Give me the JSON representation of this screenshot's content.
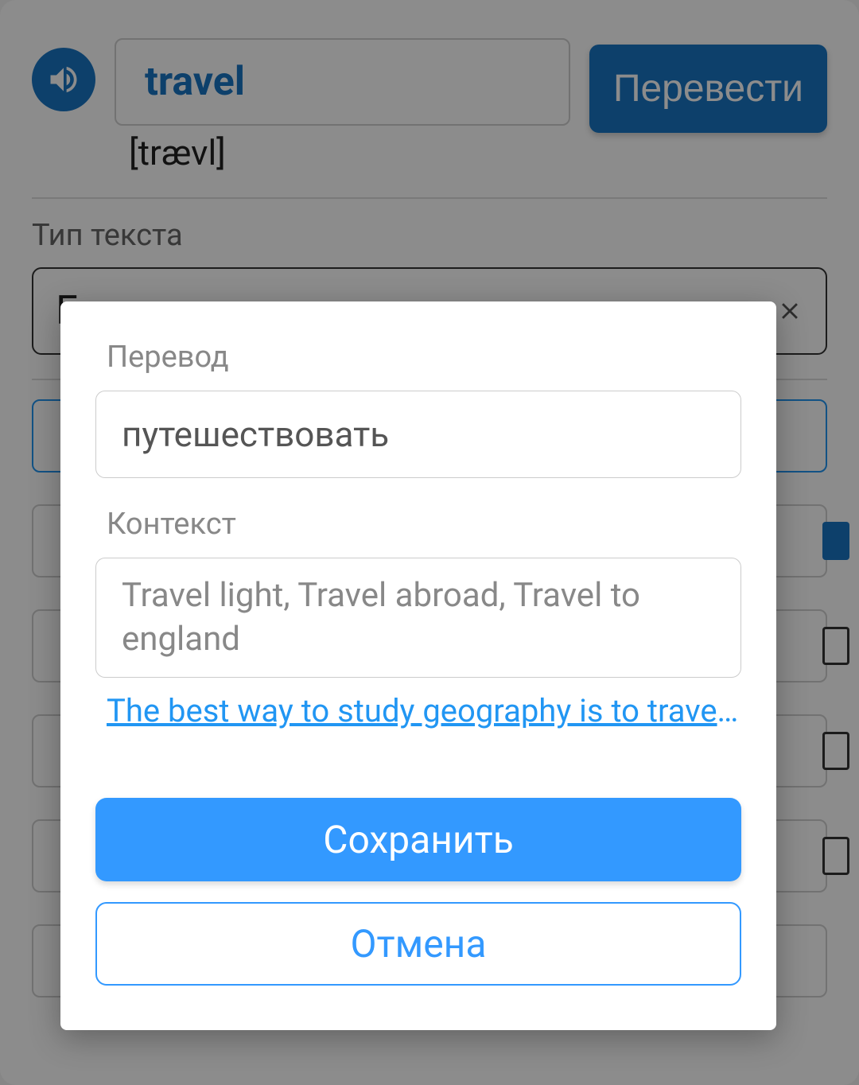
{
  "header": {
    "word": "travel",
    "phonetic": "[trævl]",
    "translate_label": "Перевести"
  },
  "bg": {
    "text_type_label": "Тип текста",
    "text_type_value": "Глагол"
  },
  "modal": {
    "translation_label": "Перевод",
    "translation_value": "путешествовать",
    "context_label": "Контекст",
    "context_value": "Travel light, Travel abroad, Travel to england",
    "suggestion_link": "The best way to study geography is to travel,..",
    "save_label": "Сохранить",
    "cancel_label": "Отмена"
  }
}
